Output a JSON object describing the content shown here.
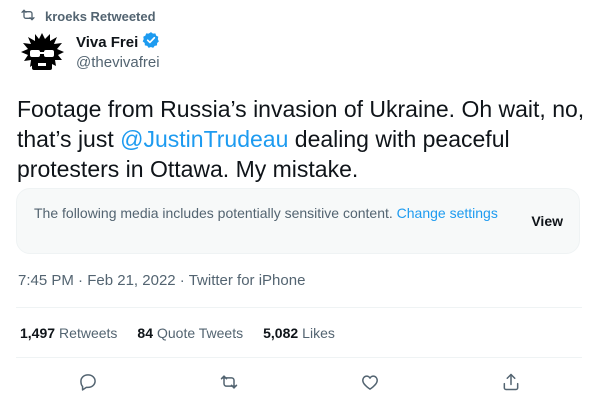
{
  "retweet": {
    "label": "kroeks Retweeted"
  },
  "author": {
    "name": "Viva Frei",
    "handle": "@thevivafrei",
    "verified": true
  },
  "tweet": {
    "text_before": "Footage from Russia’s invasion of Ukraine. Oh wait, no, that’s just ",
    "mention": "@JustinTrudeau",
    "text_after": " dealing with peaceful protesters in Ottawa. My mistake."
  },
  "sensitive_warning": {
    "text": "The following media includes potentially sensitive content.",
    "link": "Change settings",
    "button": "View"
  },
  "meta": {
    "time": "7:45 PM",
    "sep1": " · ",
    "date": "Feb 21, 2022",
    "sep2": " · ",
    "source": "Twitter for iPhone"
  },
  "stats": {
    "retweets": {
      "count": "1,497",
      "label": "Retweets"
    },
    "quotes": {
      "count": "84",
      "label": "Quote Tweets"
    },
    "likes": {
      "count": "5,082",
      "label": "Likes"
    }
  },
  "colors": {
    "accent": "#1d9bf0",
    "muted": "#536471",
    "text": "#0f1419"
  },
  "icons": [
    "retweet-icon",
    "verified-badge-icon",
    "reply-icon",
    "like-icon",
    "share-icon"
  ]
}
